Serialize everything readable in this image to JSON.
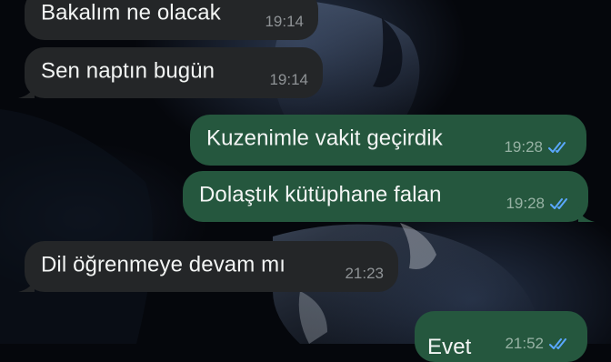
{
  "colors": {
    "incoming_bubble": "#242628",
    "outgoing_bubble": "#25573e",
    "message_text": "#f3f5f4",
    "read_ticks": "#5aa8ff"
  },
  "messages": [
    {
      "direction": "in",
      "text": "Bakalım ne olacak",
      "time": "19:14"
    },
    {
      "direction": "in",
      "text": "Sen naptın bugün",
      "time": "19:14"
    },
    {
      "direction": "out",
      "text": "Kuzenimle vakit geçirdik",
      "time": "19:28",
      "status_icon": "double-check-read-icon"
    },
    {
      "direction": "out",
      "text": "Dolaştık kütüphane falan",
      "time": "19:28",
      "status_icon": "double-check-read-icon"
    },
    {
      "direction": "in",
      "text": "Dil öğrenmeye devam mı",
      "time": "21:23"
    },
    {
      "direction": "out",
      "text": "Evet",
      "time": "21:52",
      "status_icon": "double-check-read-icon"
    }
  ]
}
